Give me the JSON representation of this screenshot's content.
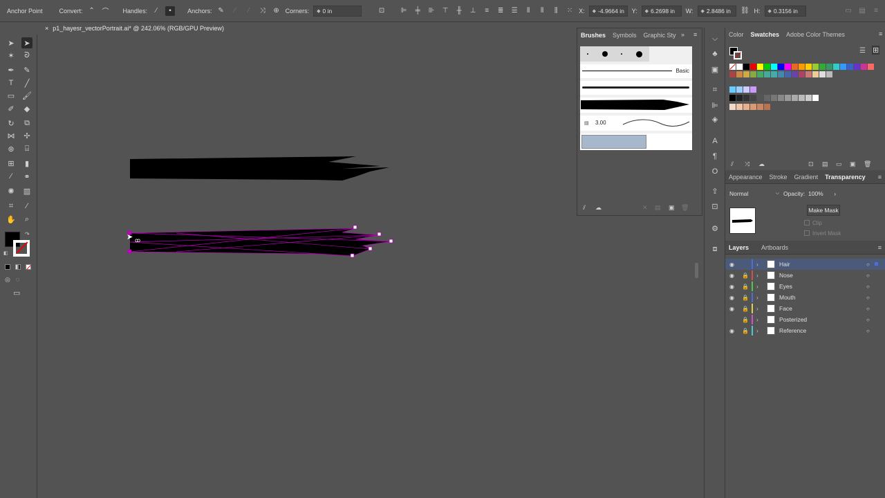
{
  "control_bar": {
    "anchor_point_label": "Anchor Point",
    "convert_label": "Convert:",
    "handles_label": "Handles:",
    "anchors_label": "Anchors:",
    "corners_label": "Corners:",
    "corners_value": "0 in",
    "x_label": "X:",
    "x_value": "-4.9664 in",
    "y_label": "Y:",
    "y_value": "6.2698 in",
    "w_label": "W:",
    "w_value": "2.8486 in",
    "h_label": "H:",
    "h_value": "0.3156 in"
  },
  "document": {
    "tab_close": "×",
    "tab_title": "p1_hayesr_vectorPortrait.ai* @ 242.06% (RGB/GPU Preview)"
  },
  "brushes_panel": {
    "tabs": [
      "Brushes",
      "Symbols",
      "Graphic Sty"
    ],
    "basic_label": "Basic",
    "pattern_size": "3.00"
  },
  "swatches_panel": {
    "tabs": [
      "Color",
      "Swatches",
      "Adobe Color Themes"
    ]
  },
  "transparency_panel": {
    "tabs": [
      "Appearance",
      "Stroke",
      "Gradient",
      "Transparency"
    ],
    "blend_mode": "Normal",
    "opacity_label": "Opacity:",
    "opacity_value": "100%",
    "make_mask_label": "Make Mask",
    "clip_label": "Clip",
    "invert_mask_label": "Invert Mask"
  },
  "layers_panel": {
    "tabs": [
      "Layers",
      "Artboards"
    ],
    "layers": [
      {
        "name": "Hair",
        "color": "#4f6ed9",
        "visible": true,
        "locked": false,
        "selected": true
      },
      {
        "name": "Nose",
        "color": "#d94f4f",
        "visible": true,
        "locked": true,
        "selected": false
      },
      {
        "name": "Eyes",
        "color": "#4fc84f",
        "visible": true,
        "locked": true,
        "selected": false
      },
      {
        "name": "Mouth",
        "color": "#4f6ed9",
        "visible": true,
        "locked": true,
        "selected": false
      },
      {
        "name": "Face",
        "color": "#e0d050",
        "visible": true,
        "locked": true,
        "selected": false
      },
      {
        "name": "Posterized",
        "color": "#d050d0",
        "visible": false,
        "locked": true,
        "selected": false
      },
      {
        "name": "Reference",
        "color": "#50c8d0",
        "visible": true,
        "locked": true,
        "selected": false
      }
    ]
  },
  "colors": {
    "selection": "#c800c8",
    "app_bg": "#535353",
    "panel_dark": "#2b2b2b"
  }
}
